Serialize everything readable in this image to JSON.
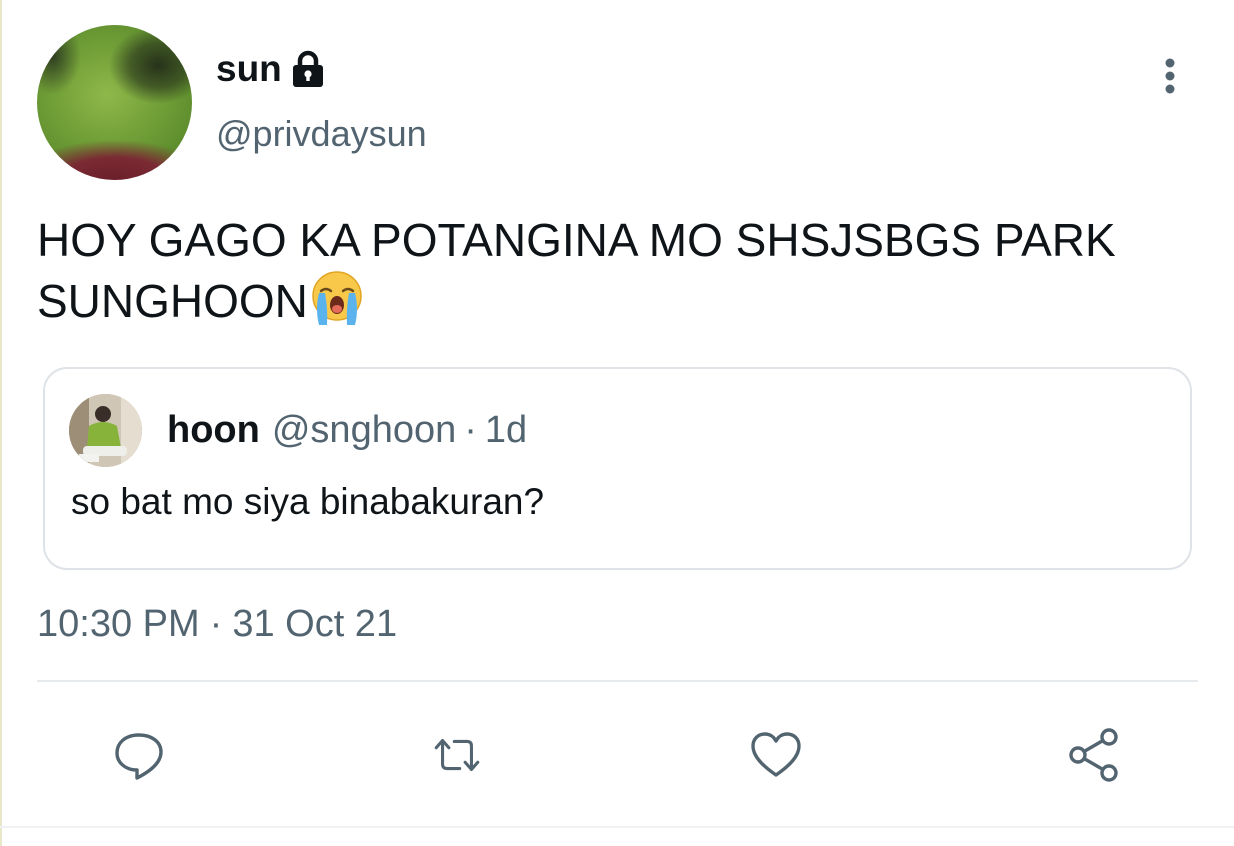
{
  "author": {
    "display_name": "sun",
    "handle": "@privdaysun",
    "protected_icon": "lock-icon",
    "avatar": "kermit-avatar"
  },
  "tweet": {
    "text": "HOY GAGO KA POTANGINA MO SHSJSBGS PARK SUNGHOON",
    "emoji": "loudly-crying-face-emoji",
    "time": "10:30 PM",
    "separator": "·",
    "date": "31 Oct 21"
  },
  "quoted_tweet": {
    "display_name": "hoon",
    "handle": "@snghoon",
    "separator": "·",
    "age": "1d",
    "text": "so bat mo siya binabakuran?"
  },
  "actions": [
    {
      "name": "reply",
      "icon": "reply-icon"
    },
    {
      "name": "retweet",
      "icon": "retweet-icon"
    },
    {
      "name": "like",
      "icon": "heart-icon"
    },
    {
      "name": "share",
      "icon": "share-icon"
    }
  ],
  "colors": {
    "text_primary": "#0f1419",
    "text_secondary": "#536471",
    "border": "#dfe3e7",
    "icon": "#536471"
  }
}
